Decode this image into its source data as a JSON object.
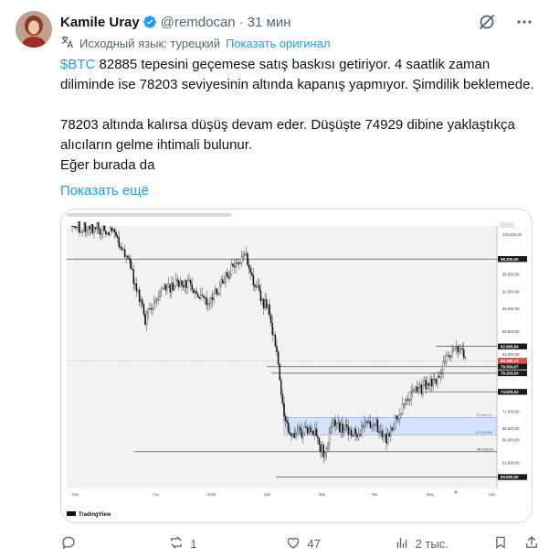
{
  "author": {
    "name": "Kamile Uray",
    "handle": "@remdocan",
    "time": "31 мин"
  },
  "translation": {
    "label": "Исходный язык: турецкий",
    "show_original": "Показать оригинал"
  },
  "tweet": {
    "cashtag": "$BTC",
    "line1_rest": " 82885 tepesini geçemese satış baskısı getiriyor.  4 saatlik zaman diliminde ise 78203  seviyesinin altında kapanış yapmıyor. Şimdilik beklemede.",
    "para2": "78203  altında kalırsa düşüş devam eder.  Düşüşte 74929 dibine yaklaştıkça alıcıların gelme ihtimali bulunur.",
    "para3": "Eğer burada da",
    "show_more": "Показать ещё"
  },
  "chart_data": {
    "type": "candlestick",
    "symbol": "BTCUSDT",
    "price_scale": [
      "102.500,00",
      "95.500,00",
      "92.500,00",
      "89.500,00",
      "85.500,00",
      "81.500,00",
      "78.500,00",
      "71.500,00",
      "68.500,00",
      "66.500,00",
      "62.500,00",
      "60.000,00"
    ],
    "price_labels": [
      {
        "value": 98200.0,
        "label": "98.200,00",
        "style": "dark"
      },
      {
        "value": 82885.84,
        "label": "82.885,84",
        "style": "dark"
      },
      {
        "value": 80389.13,
        "label": "80.389,13",
        "style": "red"
      },
      {
        "value": 79354.67,
        "label": "79.354,67",
        "style": "dark"
      },
      {
        "value": 78203.03,
        "label": "78.203,03",
        "style": "dark"
      },
      {
        "value": 74929.52,
        "label": "74.929,52",
        "style": "dark"
      },
      {
        "value": 60000.0,
        "label": "60.000,00",
        "style": "dark"
      }
    ],
    "zone": {
      "top": 70449.21,
      "bottom": 67405.86,
      "top_label": "70.449,21",
      "bottom_label": "67.405,86"
    },
    "annotation": {
      "value": 64433.95,
      "label": "64.433,95"
    },
    "x_labels": [
      "Kas",
      "Ara",
      "2026",
      "Şub",
      "Mar",
      "Nis",
      "May",
      "Haz"
    ],
    "ylim": [
      58000,
      104000
    ],
    "brand": "TradingView"
  },
  "engagement": {
    "replies": "",
    "reposts": "1",
    "likes": "47",
    "views": "2 тыс."
  },
  "colors": {
    "accent": "#1d9bf0",
    "text": "#0f1419",
    "muted": "#536471",
    "up": "#0f0f0f",
    "down": "#0f0f0f",
    "zone": "#d5e2fb"
  }
}
